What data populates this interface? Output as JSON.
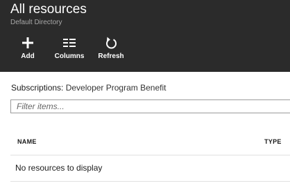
{
  "header": {
    "title": "All resources",
    "subtitle": "Default Directory",
    "background_color": "#2b2b2b"
  },
  "toolbar": {
    "add": {
      "label": "Add",
      "icon": "plus-icon"
    },
    "columns": {
      "label": "Columns",
      "icon": "columns-icon"
    },
    "refresh": {
      "label": "Refresh",
      "icon": "refresh-icon"
    }
  },
  "subscriptions": {
    "label": "Subscriptions:",
    "value": "Developer Program Benefit"
  },
  "filter": {
    "placeholder": "Filter items...",
    "value": ""
  },
  "table": {
    "columns": [
      "NAME",
      "TYPE"
    ],
    "empty_message": "No resources to display"
  }
}
